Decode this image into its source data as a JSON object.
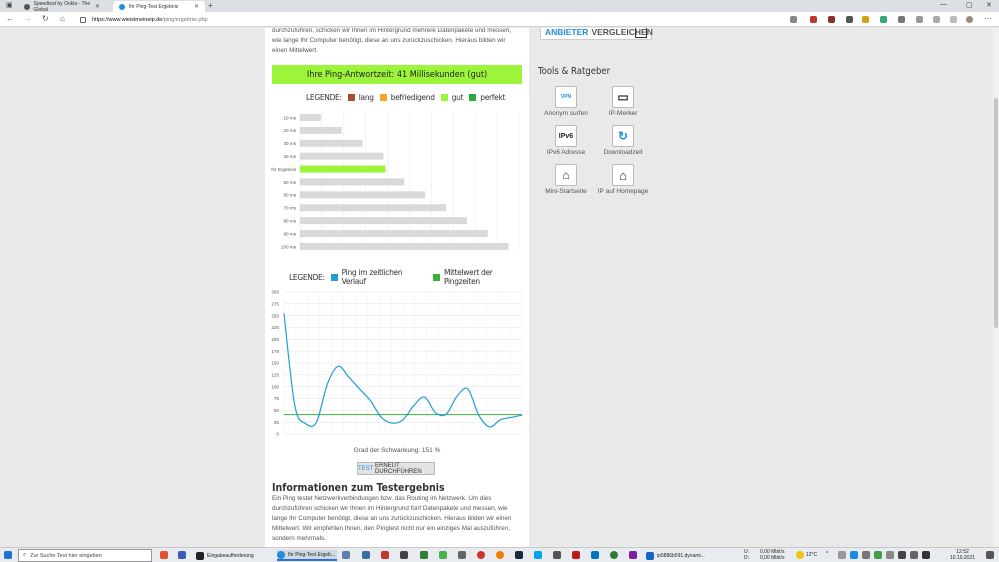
{
  "browser": {
    "tabs": [
      {
        "title": "Speedtest by Ookla - The Global"
      },
      {
        "title": "Ihr Ping-Test Ergebnis"
      }
    ],
    "url_host": "https://www.wieistmeineip.de",
    "url_path": "/ping/ergebnis.php"
  },
  "intro_text": "durchzuführen, schicken wir Ihnen im Hintergrund mehrere Datenpakete und messen, wie lange Ihr Computer benötigt, diese an uns zurückzuschicken. Hieraus bilden wir einen Mittelwert.",
  "banner": "Ihre Ping-Antwortzeit: 41 Millisekunden (gut)",
  "legend1": {
    "label": "LEGENDE:",
    "items": [
      {
        "label": "lang",
        "color": "#a0522d"
      },
      {
        "label": "befriedigend",
        "color": "#f5a623"
      },
      {
        "label": "gut",
        "color": "#9cf53a"
      },
      {
        "label": "perfekt",
        "color": "#2eaa3c"
      }
    ]
  },
  "chart_data": [
    {
      "type": "bar",
      "orientation": "horizontal",
      "categories": [
        "10 ms",
        "20 ms",
        "30 ms",
        "40 ms",
        "Ihr Ergebnis",
        "50 ms",
        "60 ms",
        "70 ms",
        "80 ms",
        "90 ms",
        "100 ms"
      ],
      "values": [
        10,
        20,
        30,
        40,
        41,
        50,
        60,
        70,
        80,
        90,
        100
      ],
      "highlight_index": 4,
      "bar_color": "#d9d9d9",
      "highlight_color": "#9cf53a",
      "xlim": [
        0,
        105
      ]
    },
    {
      "type": "line",
      "legend_label": "LEGENDE:",
      "series": [
        {
          "name": "Ping im zeitlichen Verlauf",
          "color": "#1e9fd6",
          "values": [
            255,
            60,
            22,
            25,
            105,
            143,
            120,
            95,
            70,
            35,
            23,
            30,
            60,
            78,
            45,
            42,
            80,
            95,
            40,
            15,
            30,
            35,
            40
          ]
        },
        {
          "name": "Mittelwert der Pingzeiten",
          "color": "#3cae3c",
          "values": [
            41,
            41
          ]
        }
      ],
      "yticks": [
        0,
        25,
        50,
        75,
        100,
        125,
        150,
        175,
        200,
        225,
        250,
        275,
        300
      ],
      "ylim": [
        0,
        300
      ],
      "grid": true
    }
  ],
  "variation": "Grad der Schwankung: 151 %",
  "button": {
    "part1": "TEST",
    "part2": "ERNEUT DURCHFÜHREN"
  },
  "info_heading": "Informationen zum Testergebnis",
  "info_text": "Ein Ping testet Netzwerkverbindungen bzw. das Routing im Netzwerk. Um dies durchzuführen schicken wir Ihnen im Hintergrund fünf Datenpakete und messen, wie lange Ihr Computer benötigt, diese an uns zurückzuschicken. Hieraus bilden wir einen Mittelwert. Wir empfehlen Ihnen, den Pingtest nicht nur ein einziges Mal auszuführen, sondern mehrmals.",
  "sidebar": {
    "compare": {
      "part1": "ANBIETER",
      "part2": "VERGLEICHEN"
    },
    "tools_heading": "Tools & Ratgeber",
    "tools": [
      {
        "label": "Anonym surfen",
        "icon": "vpn-shield-icon",
        "glyph": "VPN"
      },
      {
        "label": "IP-Merker",
        "icon": "monitor-icon",
        "glyph": "▭"
      },
      {
        "label": "IPv6 Adresse",
        "icon": "ipv6-icon",
        "glyph": "IPv6"
      },
      {
        "label": "Downloadzeit",
        "icon": "download-time-icon",
        "glyph": "↻"
      },
      {
        "label": "Mini-Startseite",
        "icon": "mini-home-icon",
        "glyph": "⌂"
      },
      {
        "label": "IP auf Homepage",
        "icon": "house-icon",
        "glyph": "⌂"
      }
    ]
  },
  "taskbar": {
    "search_placeholder": "Zur Suche Text hier eingeben",
    "apps": [
      {
        "label": "Eingabeaufforderung"
      },
      {
        "label": "Ihr Ping-Test Ergeb..."
      },
      {
        "label": "ip5886b591.dynami..."
      }
    ],
    "network_up": "0,00 Mbit/s",
    "network_down": "0,00 Mbit/s",
    "net_u_label": "U:",
    "net_d_label": "D:",
    "temperature": "12°C",
    "time": "12:52",
    "date": "10.10.2021"
  }
}
